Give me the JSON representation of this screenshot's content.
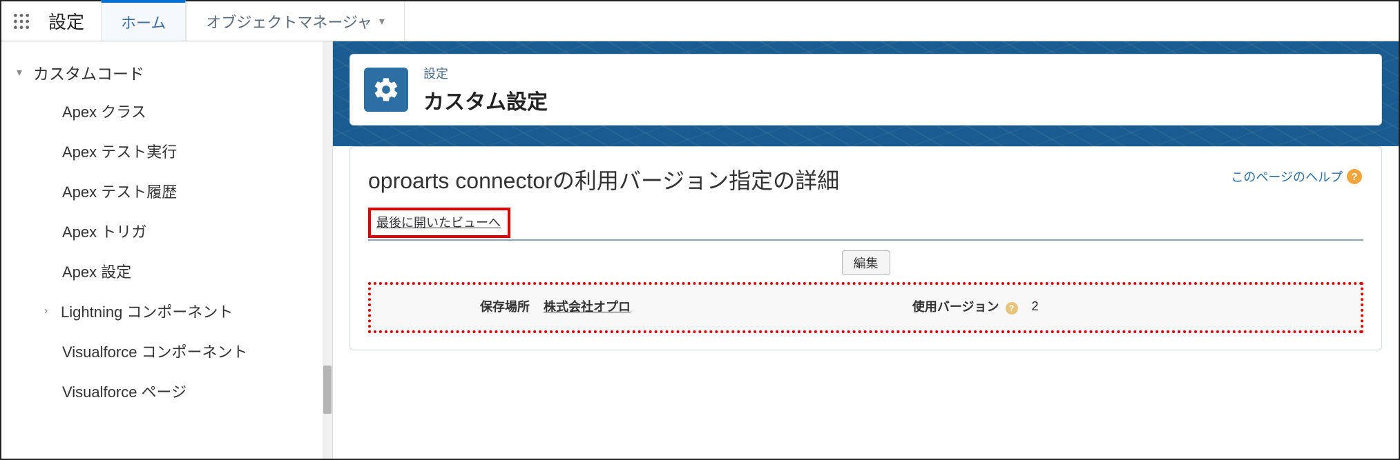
{
  "topbar": {
    "settings_label": "設定",
    "tabs": [
      {
        "label": "ホーム",
        "active": true
      },
      {
        "label": "オブジェクトマネージャ",
        "active": false,
        "has_chevron": true
      }
    ]
  },
  "sidebar": {
    "parent_label": "カスタムコード",
    "items": [
      {
        "label": "Apex クラス"
      },
      {
        "label": "Apex テスト実行"
      },
      {
        "label": "Apex テスト履歴"
      },
      {
        "label": "Apex トリガ"
      },
      {
        "label": "Apex 設定"
      },
      {
        "label": "Lightning コンポーネント",
        "has_children": true
      },
      {
        "label": "Visualforce コンポーネント"
      },
      {
        "label": "Visualforce ページ"
      }
    ]
  },
  "banner": {
    "eyebrow": "設定",
    "title": "カスタム設定"
  },
  "content": {
    "subtitle": "oproarts connectorの利用バージョン指定の詳細",
    "help_link_label": "このページのヘルプ",
    "back_link_label": "最後に開いたビューへ",
    "edit_button_label": "編集",
    "fields": {
      "location_label": "保存場所",
      "location_value": "株式会社オプロ",
      "version_label": "使用バージョン",
      "version_value": "2"
    }
  }
}
